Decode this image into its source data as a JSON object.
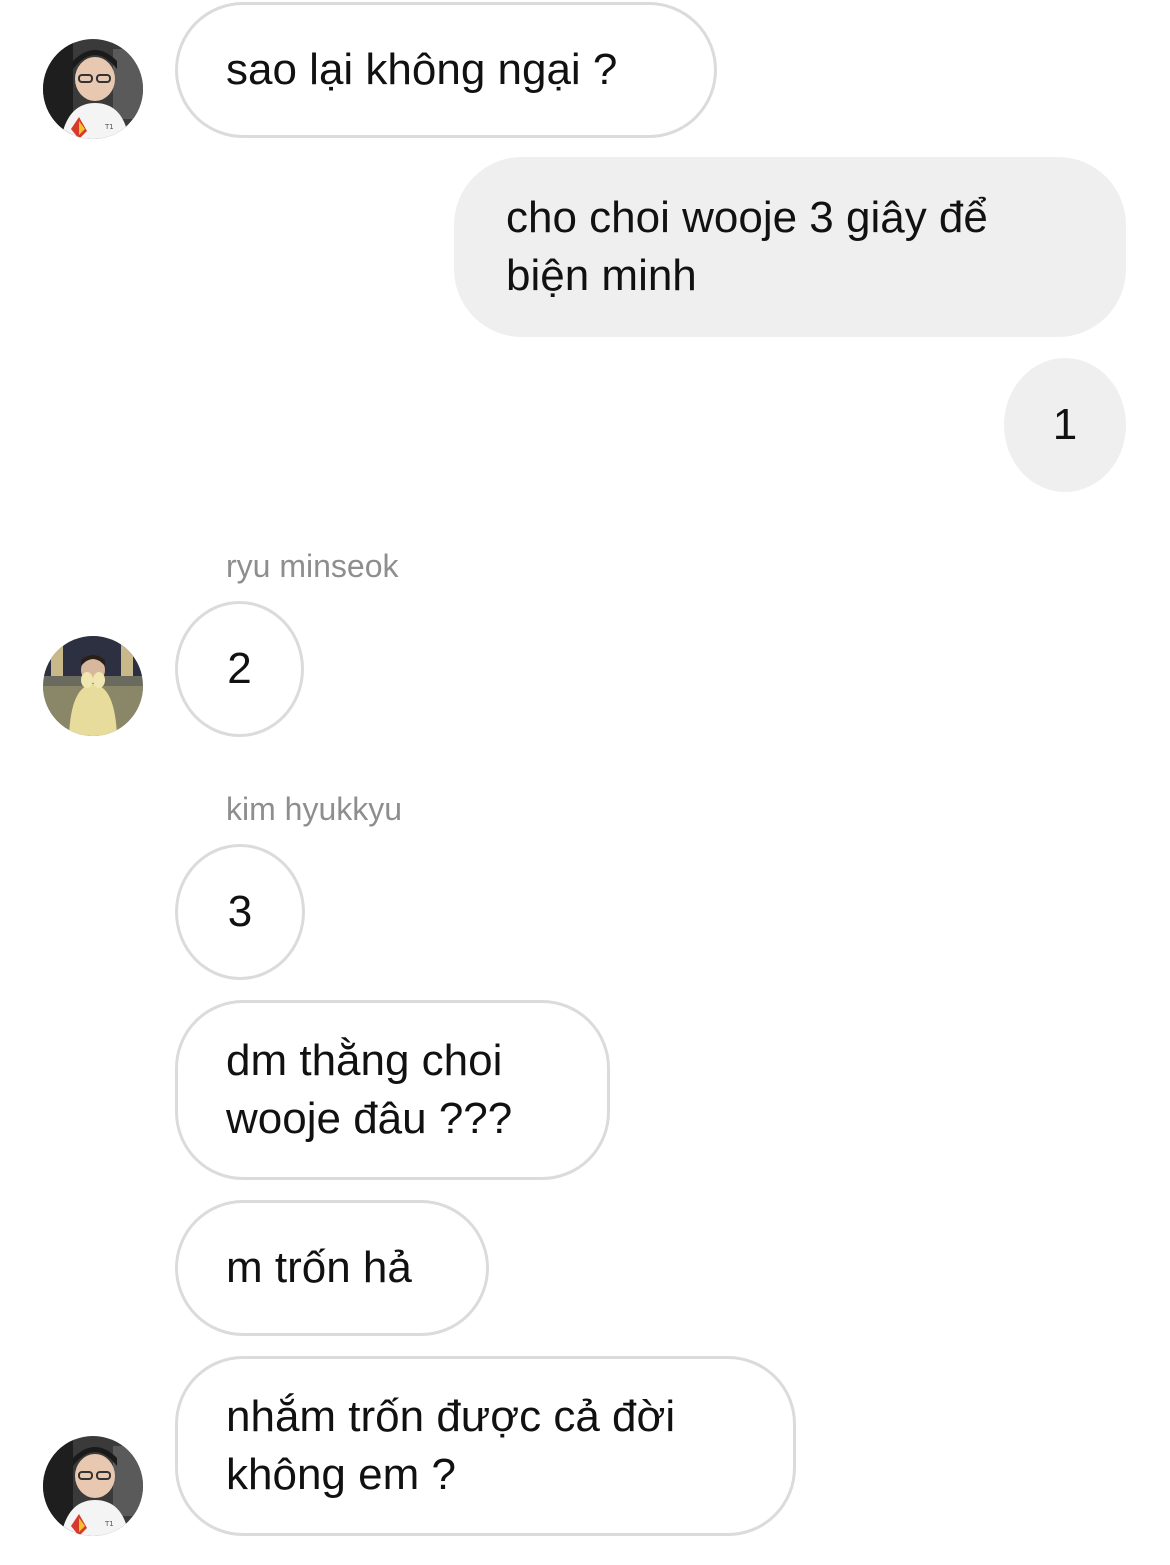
{
  "messages": [
    {
      "text": "sao lại không ngại ?"
    },
    {
      "text": "cho choi wooje 3 giây để biện minh"
    },
    {
      "text": "1"
    },
    {
      "sender": "ryu minseok",
      "text": "2"
    },
    {
      "sender": "kim hyukkyu",
      "text": "3"
    },
    {
      "text": "dm thằng choi wooje đâu ???"
    },
    {
      "text": "m trốn hả"
    },
    {
      "text": "nhắm trốn được cả đời không em ?"
    }
  ],
  "colors": {
    "incoming_border": "#dbdbdb",
    "outgoing_bg": "#efefef",
    "sender_name": "#8e8e8e"
  },
  "icons": [
    "avatar-faker",
    "avatar-keria"
  ]
}
